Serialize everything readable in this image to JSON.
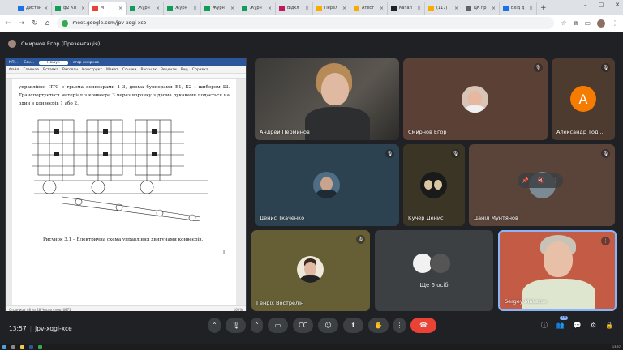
{
  "browser": {
    "tabs": [
      {
        "label": "Дистан",
        "color": "#1a73e8"
      },
      {
        "label": "ф2 КП",
        "color": "#0f9d58"
      },
      {
        "label": "М",
        "color": "#ea4335",
        "active": true
      },
      {
        "label": "Журн",
        "color": "#0f9d58"
      },
      {
        "label": "Журн",
        "color": "#0f9d58"
      },
      {
        "label": "Журн",
        "color": "#0f9d58"
      },
      {
        "label": "Журн",
        "color": "#0f9d58"
      },
      {
        "label": "Відкл",
        "color": "#c2185b"
      },
      {
        "label": "Перел",
        "color": "#f9ab00"
      },
      {
        "label": "Атест",
        "color": "#f9ab00"
      },
      {
        "label": "Катал",
        "color": "#202124"
      },
      {
        "label": "(117)",
        "color": "#f9ab00"
      },
      {
        "label": "ЦК пр",
        "color": "#5f6368"
      },
      {
        "label": "Вхід д",
        "color": "#1a73e8"
      }
    ],
    "url": "meet.google.com/jpv-xqgi-xce"
  },
  "meet": {
    "presenter_label": "Смирнов Егор (Презентація)",
    "time": "13:57",
    "meeting_code": "jpv-xqgi-xce",
    "participants_badge": "10",
    "overflow_label": "Ще 6 осіб",
    "tiles": [
      {
        "name": "Андрей Перминов"
      },
      {
        "name": "Смирнов Егор"
      },
      {
        "name": "Александр Тод..."
      },
      {
        "name": "Денис Ткаченко"
      },
      {
        "name": "Кучер Денис"
      },
      {
        "name": "Даніл Мунтянов"
      },
      {
        "name": "Генріх Вострелін"
      },
      {
        "name": "Sergey Makarov"
      }
    ],
    "letter_avatar": "A"
  },
  "document": {
    "window_title": "КП... — Сох...",
    "user_label": "егор смирнов",
    "menu": [
      "Файл",
      "Главная",
      "Вставка",
      "Рисован",
      "Конструкт",
      "Макет",
      "Ссылки",
      "Рассылк",
      "Рецензи",
      "Вид",
      "Справка"
    ],
    "body_text": "управління ПТС з трьома конвеєрами 1–3, двома бункерами Б1, Б2 і шибером Ш. Транспортується матеріал з конвеєра 3 через воронку з двома рукавами подається на один з конвеєрів 1 або 2.",
    "caption": "Рисунок  3.1 – Електрична схема управління двигунами конвеєрів.",
    "status": "Страница 48 из 48    Число слов: 6871",
    "zoom": "100%"
  },
  "taskbar": {
    "clock": "13:57"
  }
}
